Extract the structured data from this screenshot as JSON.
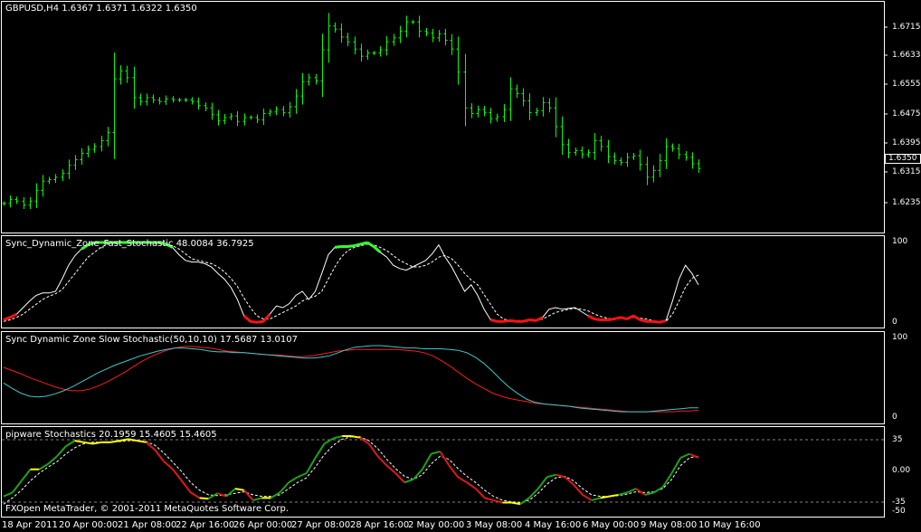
{
  "panes": {
    "main": {
      "title": "GBPUSD,H4  1.6367 1.6371 1.6322 1.6350",
      "scale": [
        "1.6715",
        "1.6633",
        "1.6555",
        "1.6475",
        "1.6395",
        "1.6315",
        "1.6235"
      ],
      "current_price": "1.6350"
    },
    "fast": {
      "title": "Sync_Dynamic_Zone_Fast_Stochastic 48.0084 36.7925",
      "scale": [
        "100",
        "0"
      ]
    },
    "slow": {
      "title": "Sync Dynamic Zone Slow Stochastic(50,10,10) 17.5687 13.0107",
      "scale": [
        "100",
        "0"
      ]
    },
    "pipware": {
      "title": "pipware Stochastics 20.1959 15.4605 15.4605",
      "scale": [
        "35",
        "0.00",
        "-35",
        "-50"
      ]
    }
  },
  "x_axis": [
    "18 Apr 2011",
    "20 Apr 00:00",
    "21 Apr 08:00",
    "22 Apr 16:00",
    "26 Apr 00:00",
    "27 Apr 08:00",
    "28 Apr 16:00",
    "2 May 00:00",
    "3 May 08:00",
    "4 May 16:00",
    "6 May 00:00",
    "9 May 08:00",
    "10 May 16:00"
  ],
  "footer": {
    "copyright": "FXOpen MetaTrader, © 2001-2011 MetaQuotes Software Corp."
  },
  "chart_data": [
    {
      "type": "bar",
      "title": "GBPUSD,H4  1.6367 1.6371 1.6322 1.6350",
      "ylim": [
        1.6205,
        1.6755
      ],
      "colors": {
        "bars": "#00ff00"
      },
      "closes": [
        1.6262,
        1.6272,
        1.6268,
        1.6258,
        1.6268,
        1.6295,
        1.6318,
        1.6322,
        1.6328,
        1.6338,
        1.6358,
        1.6372,
        1.6388,
        1.6398,
        1.6405,
        1.642,
        1.644,
        1.6575,
        1.6595,
        1.6578,
        1.6528,
        1.6518,
        1.6528,
        1.6522,
        1.6518,
        1.6525,
        1.6522,
        1.6522,
        1.6522,
        1.6518,
        1.6508,
        1.6502,
        1.6485,
        1.647,
        1.6478,
        1.6482,
        1.6468,
        1.6478,
        1.6478,
        1.6472,
        1.6488,
        1.6492,
        1.6498,
        1.649,
        1.6505,
        1.6532,
        1.6568,
        1.6578,
        1.657,
        1.6648,
        1.6708,
        1.67,
        1.668,
        1.6668,
        1.665,
        1.6632,
        1.664,
        1.664,
        1.6648,
        1.6668,
        1.6678,
        1.6695,
        1.6718,
        1.6718,
        1.6695,
        1.669,
        1.6678,
        1.6688,
        1.6672,
        1.665,
        1.6592,
        1.6502,
        1.6488,
        1.6498,
        1.649,
        1.6475,
        1.648,
        1.6498,
        1.655,
        1.6538,
        1.652,
        1.649,
        1.6495,
        1.6515,
        1.6502,
        1.6455,
        1.641,
        1.639,
        1.6395,
        1.6385,
        1.639,
        1.642,
        1.6405,
        1.638,
        1.637,
        1.6365,
        1.6378,
        1.6382,
        1.636,
        1.6328,
        1.6345,
        1.637,
        1.6405,
        1.64,
        1.6385,
        1.6378,
        1.6362,
        1.635
      ],
      "series": []
    },
    {
      "type": "line",
      "title": "Sync_Dynamic_Zone_Fast_Stochastic 48.0084 36.7925",
      "ylim": [
        0,
        100
      ],
      "colors": {
        "main": "#ffffff",
        "signal": "#ffffff",
        "upper_zone": "#33ff33",
        "lower_zone": "#ff1010"
      },
      "series": [
        {
          "values": [
            5,
            8,
            12,
            20,
            28,
            35,
            38,
            38,
            40,
            55,
            72,
            84,
            92,
            97,
            100,
            100,
            100,
            100,
            100,
            100,
            100,
            100,
            100,
            100,
            100,
            98,
            94,
            85,
            78,
            76,
            76,
            74,
            70,
            62,
            55,
            45,
            30,
            10,
            3,
            2,
            3,
            12,
            22,
            20,
            25,
            35,
            40,
            30,
            40,
            62,
            85,
            94,
            95,
            95,
            96,
            98,
            100,
            95,
            88,
            82,
            72,
            68,
            66,
            70,
            74,
            78,
            86,
            97,
            82,
            70,
            55,
            40,
            48,
            35,
            18,
            5,
            3,
            3,
            4,
            3,
            3,
            5,
            4,
            8,
            18,
            20,
            18,
            19,
            20,
            15,
            10,
            6,
            5,
            5,
            6,
            8,
            6,
            10,
            5,
            3,
            3,
            2,
            4,
            28,
            55,
            72,
            62,
            48
          ]
        },
        {
          "values": [
            3,
            5,
            8,
            12,
            18,
            24,
            30,
            34,
            37,
            42,
            52,
            62,
            72,
            82,
            88,
            94,
            98,
            100,
            100,
            100,
            100,
            100,
            100,
            100,
            99,
            98,
            96,
            92,
            86,
            80,
            78,
            76,
            74,
            70,
            64,
            56,
            46,
            32,
            20,
            10,
            6,
            6,
            10,
            14,
            18,
            22,
            28,
            32,
            34,
            40,
            55,
            70,
            82,
            90,
            94,
            96,
            98,
            97,
            94,
            90,
            84,
            78,
            74,
            70,
            70,
            72,
            76,
            82,
            84,
            80,
            72,
            62,
            54,
            48,
            36,
            24,
            12,
            6,
            4,
            4,
            4,
            4,
            4,
            6,
            10,
            14,
            16,
            18,
            19,
            18,
            16,
            12,
            9,
            7,
            6,
            7,
            7,
            8,
            7,
            6,
            4,
            3,
            3,
            12,
            28,
            45,
            56,
            60
          ]
        }
      ]
    },
    {
      "type": "line",
      "title": "Sync Dynamic Zone Slow Stochastic(50,10,10) 17.5687 13.0107",
      "ylim": [
        0,
        100
      ],
      "colors": {
        "main": "#40c8c8",
        "signal": "#ff1a1a"
      },
      "series": [
        {
          "values": [
            45,
            38,
            32,
            28,
            27,
            28,
            31,
            35,
            40,
            46,
            52,
            58,
            63,
            68,
            72,
            76,
            80,
            83,
            86,
            88,
            90,
            90,
            89,
            88,
            86,
            85,
            85,
            84,
            84,
            83,
            82,
            81,
            80,
            79,
            78,
            77,
            77,
            78,
            80,
            84,
            88,
            91,
            92,
            93,
            93,
            92,
            91,
            90,
            90,
            89,
            89,
            89,
            88,
            87,
            84,
            78,
            70,
            60,
            49,
            39,
            31,
            24,
            20,
            18,
            17,
            16,
            15,
            13,
            12,
            11,
            10,
            9,
            8,
            8,
            8,
            8,
            9,
            10,
            11,
            12,
            13,
            13
          ]
        },
        {
          "values": [
            65,
            61,
            57,
            52,
            48,
            44,
            40,
            37,
            35,
            35,
            37,
            41,
            46,
            52,
            58,
            65,
            72,
            78,
            83,
            87,
            90,
            92,
            92,
            91,
            90,
            88,
            86,
            85,
            84,
            83,
            82,
            81,
            81,
            80,
            79,
            79,
            80,
            82,
            84,
            86,
            87,
            88,
            88,
            88,
            88,
            88,
            88,
            87,
            86,
            84,
            80,
            74,
            67,
            59,
            51,
            44,
            38,
            32,
            28,
            25,
            23,
            21,
            19,
            18,
            17,
            16,
            15,
            14,
            13,
            12,
            11,
            10,
            9,
            8,
            8,
            8,
            8,
            8,
            8,
            9,
            9,
            10
          ]
        }
      ]
    },
    {
      "type": "line",
      "title": "pipware Stochastics 20.1959 15.4605 15.4605",
      "ylim": [
        -55,
        55
      ],
      "levels": [
        35,
        -35
      ],
      "colors": {
        "main_up": "#1aa31a",
        "main_down": "#e01818",
        "main_flat": "#ffff00",
        "signal": "#ffffff",
        "levels": "#808080"
      },
      "series": [
        {
          "values": [
            -30,
            -25,
            -10,
            5,
            5,
            12,
            22,
            35,
            42,
            40,
            38,
            40,
            40,
            42,
            44,
            42,
            40,
            30,
            15,
            5,
            -10,
            -25,
            -32,
            -33,
            -26,
            -30,
            -20,
            -22,
            -35,
            -32,
            -32,
            -25,
            -12,
            -5,
            0,
            20,
            38,
            45,
            48,
            48,
            46,
            38,
            22,
            10,
            0,
            -12,
            -8,
            5,
            25,
            28,
            10,
            -5,
            -12,
            -20,
            -32,
            -35,
            -38,
            -38,
            -40,
            -32,
            -20,
            -5,
            -2,
            -5,
            -15,
            -28,
            -35,
            -32,
            -30,
            -28,
            -25,
            -20,
            -28,
            -25,
            -18,
            0,
            20,
            25,
            20
          ]
        },
        {
          "values": [
            -40,
            -32,
            -22,
            -10,
            0,
            8,
            15,
            25,
            33,
            38,
            40,
            40,
            40,
            41,
            42,
            42,
            41,
            36,
            26,
            14,
            2,
            -12,
            -22,
            -28,
            -29,
            -28,
            -26,
            -24,
            -28,
            -30,
            -30,
            -28,
            -20,
            -12,
            -6,
            8,
            24,
            36,
            44,
            47,
            47,
            42,
            32,
            18,
            6,
            -4,
            -8,
            -2,
            12,
            22,
            18,
            6,
            -4,
            -12,
            -22,
            -30,
            -35,
            -37,
            -38,
            -35,
            -26,
            -14,
            -6,
            -4,
            -10,
            -20,
            -28,
            -30,
            -30,
            -29,
            -27,
            -24,
            -25,
            -24,
            -20,
            -8,
            10,
            20,
            22
          ]
        }
      ]
    }
  ]
}
